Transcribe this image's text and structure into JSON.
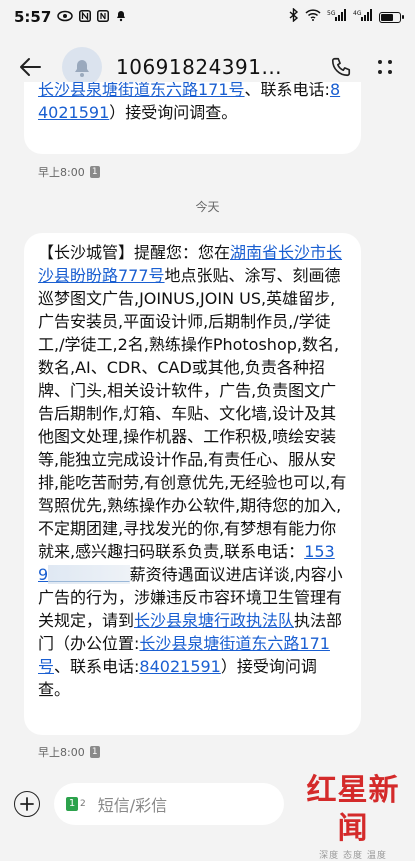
{
  "status_bar": {
    "time": "5:57",
    "indicators": [
      "eye-icon",
      "n-icon",
      "nfc-icon",
      "mute-icon"
    ],
    "right_icons": [
      "bluetooth-icon",
      "wifi-icon",
      "signal-5g-icon",
      "signal-4g-icon",
      "battery-icon"
    ]
  },
  "header": {
    "sender": "10691824391..."
  },
  "messages": [
    {
      "segments": [
        {
          "text": "长沙县泉塘街道东六路171号",
          "link": true
        },
        {
          "text": "、联系电话:",
          "link": false
        },
        {
          "text": "84021591",
          "link": true
        },
        {
          "text": "）接受询问调查。",
          "link": false
        }
      ],
      "time": "早上8:00",
      "sim": "1"
    },
    {
      "segments": [
        {
          "text": "【长沙城管】提醒您：您在",
          "link": false
        },
        {
          "text": "湖南省长沙市长沙县盼盼路777号",
          "link": true
        },
        {
          "text": "地点张贴、涂写、刻画德巡梦图文广告,JOINUS,JOIN US,英雄留步,广告安装员,平面设计师,后期制作员,/学徒工,/学徒工,2名,熟练操作Photoshop,数名,数名,AI、CDR、CAD或其他,负责各种招牌、门头,相关设计软件，广告,负责图文广告后期制作,灯箱、车贴、文化墙,设计及其他图文处理,操作机器、工作积极,喷绘安装等,能独立完成设计作品,有责任心、服从安排,能吃苦耐劳,有创意优先,无经验也可以,有驾照优先,熟练操作办公软件,期待您的加入,不定期团建,寻找发光的你,有梦想有能力你就来,感兴趣扫码联系负责,联系电话：",
          "link": false
        },
        {
          "text": "1539",
          "link": true
        },
        {
          "text": "        ",
          "link": "blur"
        },
        {
          "text": "薪资待遇面议进店详谈,内容小广告的行为，涉嫌违反市容环境卫生管理有关规定，请到",
          "link": false
        },
        {
          "text": "长沙县泉塘行政执法队",
          "link": true
        },
        {
          "text": "执法部门（办公位置:",
          "link": false
        },
        {
          "text": "长沙县泉塘街道东六路171号",
          "link": true
        },
        {
          "text": "、联系电话:",
          "link": false
        },
        {
          "text": "84021591",
          "link": true
        },
        {
          "text": "）接受询问调查。",
          "link": false
        }
      ],
      "time": "早上8:00",
      "sim": "1"
    }
  ],
  "day_label": "今天",
  "composer": {
    "sim_number": "1",
    "sim_sub": "2",
    "placeholder": "短信/彩信"
  },
  "watermark": {
    "title": "红星新闻",
    "subtitle": "深度 态度 温度"
  }
}
